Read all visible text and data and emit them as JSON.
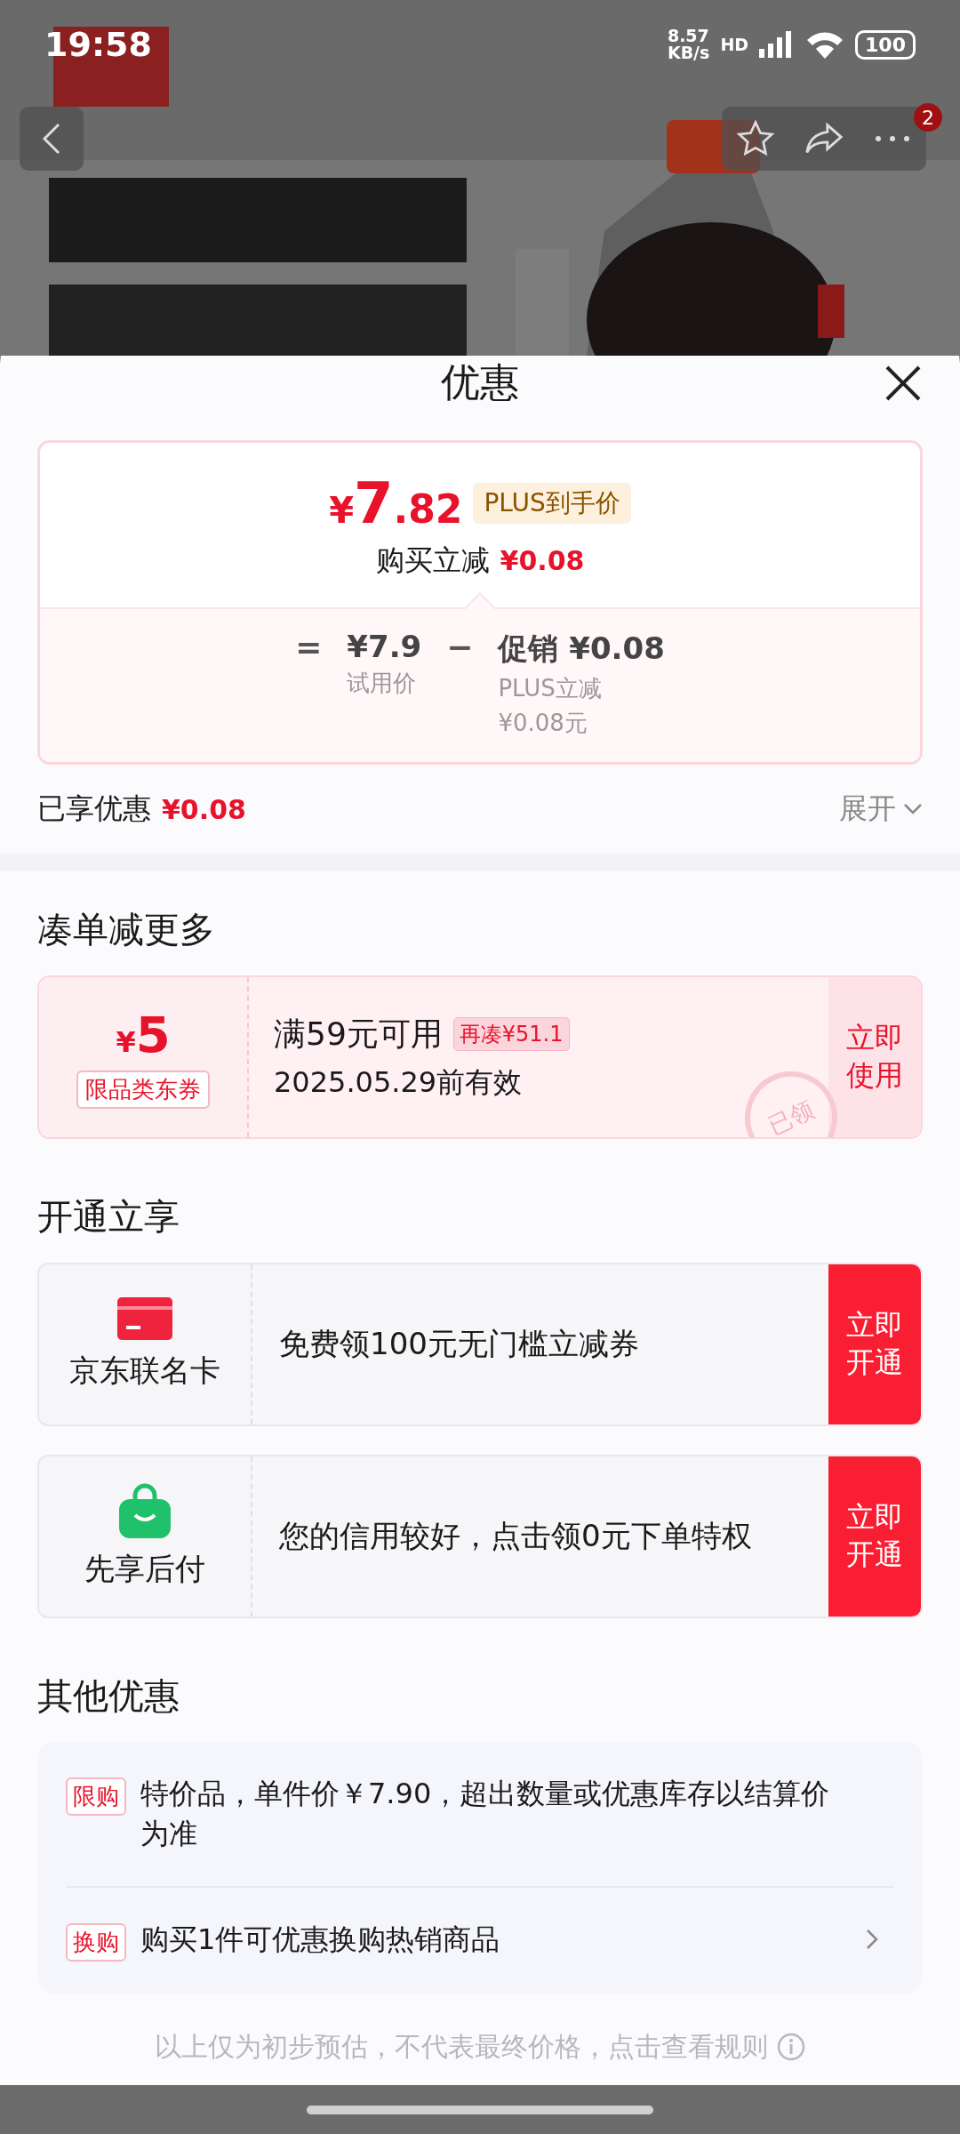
{
  "status_bar": {
    "time": "19:58",
    "speed_value": "8.57",
    "speed_unit": "KB/s",
    "network": "HD",
    "battery": "100"
  },
  "header": {
    "badge": "2"
  },
  "sheet": {
    "title": "优惠"
  },
  "price_card": {
    "currency": "¥",
    "price_int": "7",
    "price_dec": ".82",
    "tag": "PLUS到手价",
    "instant_label": "购买立减",
    "instant_amount": "¥0.08",
    "breakdown": {
      "equals": "=",
      "base_price": "¥7.9",
      "base_label": "试用价",
      "minus": "−",
      "promo_title": "促销 ¥0.08",
      "promo_lines": [
        "PLUS立减",
        "¥0.08元"
      ]
    }
  },
  "enjoyed": {
    "label": "已享优惠",
    "amount": "¥0.08",
    "expand": "展开"
  },
  "coupon_section": {
    "title": "凑单减更多",
    "coupon": {
      "currency": "¥",
      "amount": "5",
      "type": "限品类东券",
      "condition": "满59元可用",
      "tag": "再凑¥51.1",
      "validity": "2025.05.29前有效",
      "action": "立即使用",
      "claimed": true,
      "stamp": "已领"
    }
  },
  "open_section": {
    "title": "开通立享",
    "offers": [
      {
        "kind": "card",
        "name": "京东联名卡",
        "desc": "免费领100元无门槛立减券",
        "action": "立即开通"
      },
      {
        "kind": "bag",
        "name": "先享后付",
        "desc": "您的信用较好，点击领0元下单特权",
        "action": "立即开通"
      }
    ]
  },
  "other_section": {
    "title": "其他优惠",
    "items": [
      {
        "tag": "限购",
        "text": "特价品，单件价￥7.90，超出数量或优惠库存以结算价为准",
        "arrow": false
      },
      {
        "tag": "换购",
        "text": "购买1件可优惠换购热销商品",
        "arrow": true
      }
    ]
  },
  "footer": {
    "note": "以上仅为初步预估，不代表最终价格，点击查看规则"
  }
}
